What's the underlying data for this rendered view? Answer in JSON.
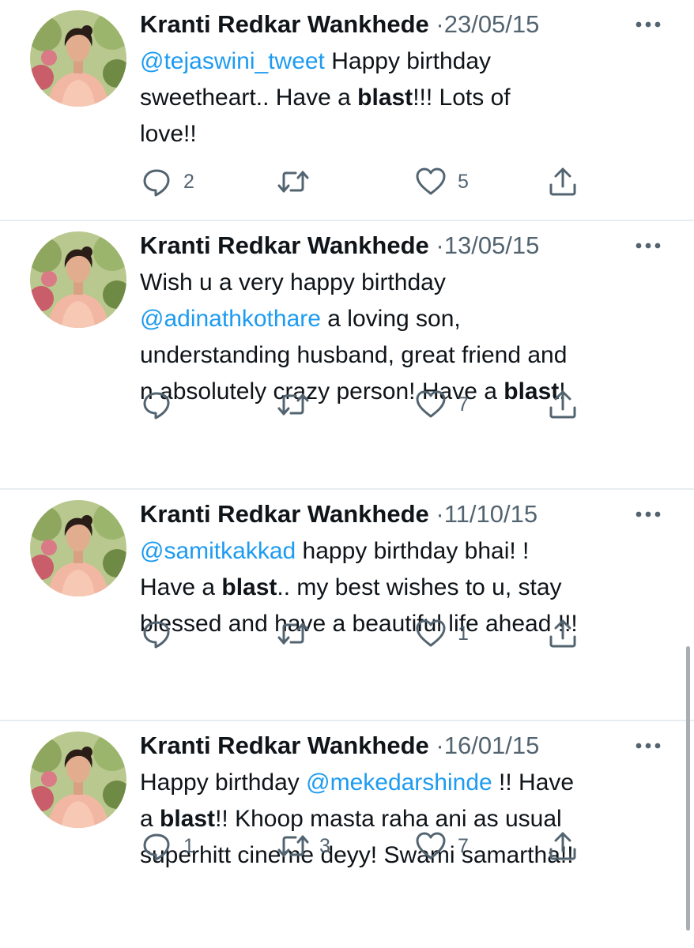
{
  "tweets": [
    {
      "author": "Kranti Redkar Wankhede",
      "separator": "·",
      "date": "23/05/15",
      "lines": [
        [
          {
            "text": "@tejaswini_tweet",
            "style": "mention"
          },
          {
            "text": "  Happy birthday"
          }
        ],
        [
          {
            "text": "sweetheart..  Have a "
          },
          {
            "text": "blast",
            "style": "bold"
          },
          {
            "text": "!!!  Lots of"
          }
        ],
        [
          {
            "text": "love!!"
          }
        ]
      ],
      "replies": "2",
      "retweets": "",
      "likes": "5"
    },
    {
      "author": "Kranti Redkar Wankhede",
      "separator": "·",
      "date": "13/05/15",
      "lines": [
        [
          {
            "text": "Wish u a very happy birthday"
          }
        ],
        [
          {
            "text": "@adinathkothare",
            "style": "mention"
          },
          {
            "text": " a loving son,"
          }
        ],
        [
          {
            "text": "understanding husband, great friend and"
          }
        ],
        [
          {
            "text": "n absolutely crazy person! Have a "
          },
          {
            "text": "blast",
            "style": "bold"
          },
          {
            "text": "!"
          }
        ]
      ],
      "replies": "",
      "retweets": "",
      "likes": "7"
    },
    {
      "author": "Kranti Redkar Wankhede",
      "separator": "·",
      "date": "11/10/15",
      "lines": [
        [
          {
            "text": "@samitkakkad",
            "style": "mention"
          },
          {
            "text": " happy birthday bhai! !"
          }
        ],
        [
          {
            "text": "Have a "
          },
          {
            "text": "blast",
            "style": "bold"
          },
          {
            "text": ".. my best wishes to u, stay"
          }
        ],
        [
          {
            "text": "blessed and have a beautiful life ahead !!!"
          }
        ]
      ],
      "replies": "",
      "retweets": "",
      "likes": "1"
    },
    {
      "author": "Kranti Redkar Wankhede",
      "separator": "·",
      "date": "16/01/15",
      "lines": [
        [
          {
            "text": "Happy birthday "
          },
          {
            "text": "@mekedarshinde",
            "style": "mention"
          },
          {
            "text": " !! Have"
          }
        ],
        [
          {
            "text": "a "
          },
          {
            "text": "blast",
            "style": "bold"
          },
          {
            "text": "!!  Khoop masta raha ani as usual"
          }
        ],
        [
          {
            "text": "superhitt cineme deyy!  Swami samartha!!"
          }
        ]
      ],
      "replies": "1",
      "retweets": "3",
      "likes": "7"
    }
  ],
  "icons": {
    "reply": "reply-icon",
    "retweet": "retweet-icon",
    "like": "heart-icon",
    "share": "share-icon",
    "more": "more-options-icon"
  },
  "colors": {
    "text": "#0f1419",
    "secondary": "#536471",
    "mention": "#1d9bf0",
    "divider": "#e6ecf0"
  }
}
